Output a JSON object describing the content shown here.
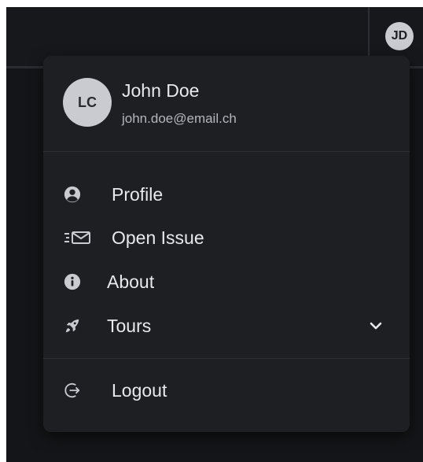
{
  "topbar": {
    "avatar_initials": "JD"
  },
  "account_menu": {
    "avatar_initials": "LC",
    "user_name": "John Doe",
    "user_email": "john.doe@email.ch",
    "items": [
      {
        "label": "Profile",
        "icon": "user-circle-icon"
      },
      {
        "label": "Open Issue",
        "icon": "mail-send-icon"
      },
      {
        "label": "About",
        "icon": "info-icon"
      },
      {
        "label": "Tours",
        "icon": "rocket-icon",
        "expandable": true
      }
    ],
    "logout_label": "Logout"
  },
  "colors": {
    "background": "#141518",
    "menu_background": "#1e1f23",
    "avatar": "#c9cbd1",
    "text_primary": "#e8e9ec",
    "text_secondary": "#b4b6bc"
  }
}
